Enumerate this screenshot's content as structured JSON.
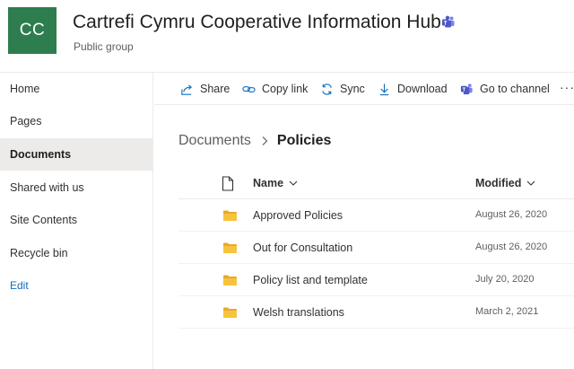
{
  "site": {
    "logo_initials": "CC",
    "title": "Cartrefi Cymru Cooperative Information Hub",
    "subtitle": "Public group",
    "teams_icon": "teams-icon",
    "logo_color": "#2e7d4f"
  },
  "nav": {
    "items": [
      {
        "label": "Home"
      },
      {
        "label": "Pages"
      },
      {
        "label": "Documents"
      },
      {
        "label": "Shared with us"
      },
      {
        "label": "Site Contents"
      },
      {
        "label": "Recycle bin"
      }
    ],
    "selected": "Documents",
    "edit_label": "Edit"
  },
  "commandbar": {
    "share": "Share",
    "copy_link": "Copy link",
    "sync": "Sync",
    "download": "Download",
    "go_to_channel": "Go to channel",
    "more": "···"
  },
  "breadcrumb": {
    "root": "Documents",
    "current": "Policies"
  },
  "table": {
    "columns": {
      "name": "Name",
      "modified": "Modified"
    },
    "rows": [
      {
        "name": "Approved Policies",
        "modified": "August 26, 2020",
        "type": "folder"
      },
      {
        "name": "Out for Consultation",
        "modified": "August 26, 2020",
        "type": "folder"
      },
      {
        "name": "Policy list and template",
        "modified": "July 20, 2020",
        "type": "folder"
      },
      {
        "name": "Welsh translations",
        "modified": "March 2, 2021",
        "type": "folder"
      }
    ]
  },
  "colors": {
    "accent": "#0f6cbd",
    "folder": "#f8c33c",
    "teams": "#5059c9"
  }
}
